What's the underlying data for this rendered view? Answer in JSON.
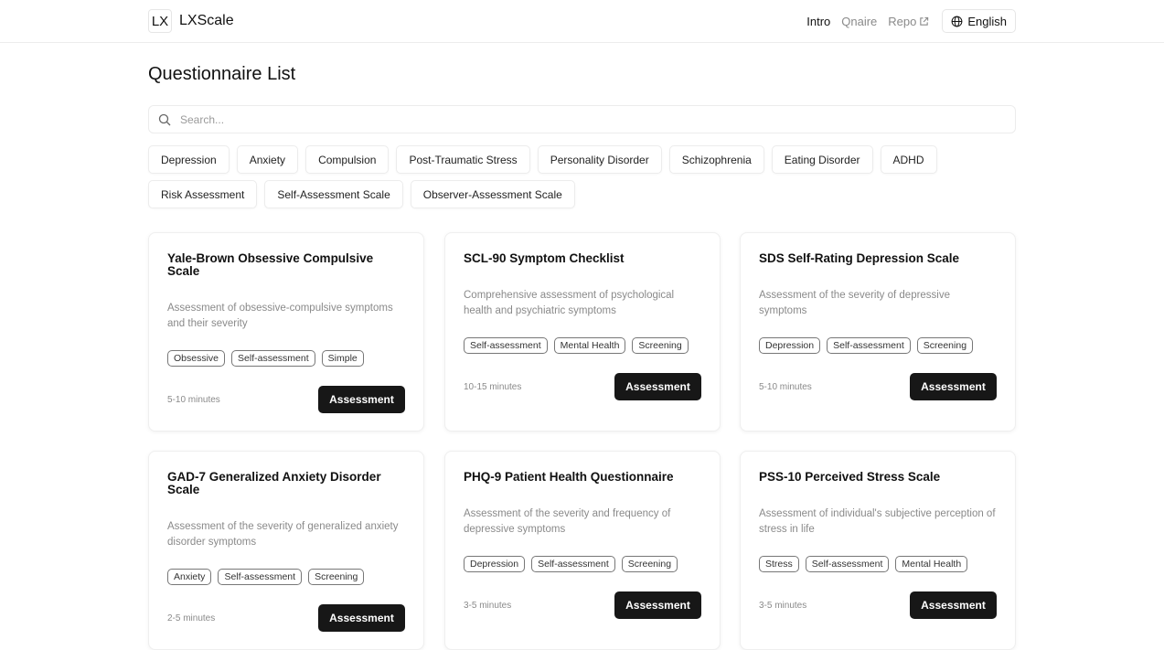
{
  "brand": {
    "mark": "LX",
    "name": "LXScale"
  },
  "nav": {
    "intro": "Intro",
    "qnaire": "Qnaire",
    "repo": "Repo",
    "language": "English"
  },
  "page": {
    "title": "Questionnaire List"
  },
  "search": {
    "placeholder": "Search...",
    "value": ""
  },
  "filters": {
    "row1": [
      "Depression",
      "Anxiety",
      "Compulsion",
      "Post-Traumatic Stress",
      "Personality Disorder",
      "Schizophrenia",
      "Eating Disorder",
      "ADHD"
    ],
    "row2": [
      "Risk Assessment",
      "Self-Assessment Scale",
      "Observer-Assessment Scale"
    ]
  },
  "cards": [
    {
      "title": "Yale-Brown Obsessive Compulsive Scale",
      "description": "Assessment of obsessive-compulsive symptoms and their severity",
      "tags": [
        "Obsessive",
        "Self-assessment",
        "Simple"
      ],
      "duration": "5-10 minutes",
      "button": "Assessment"
    },
    {
      "title": "SCL-90 Symptom Checklist",
      "description": "Comprehensive assessment of psychological health and psychiatric symptoms",
      "tags": [
        "Self-assessment",
        "Mental Health",
        "Screening"
      ],
      "duration": "10-15 minutes",
      "button": "Assessment"
    },
    {
      "title": "SDS Self-Rating Depression Scale",
      "description": "Assessment of the severity of depressive symptoms",
      "tags": [
        "Depression",
        "Self-assessment",
        "Screening"
      ],
      "duration": "5-10 minutes",
      "button": "Assessment"
    },
    {
      "title": "GAD-7 Generalized Anxiety Disorder Scale",
      "description": "Assessment of the severity of generalized anxiety disorder symptoms",
      "tags": [
        "Anxiety",
        "Self-assessment",
        "Screening"
      ],
      "duration": "2-5 minutes",
      "button": "Assessment"
    },
    {
      "title": "PHQ-9 Patient Health Questionnaire",
      "description": "Assessment of the severity and frequency of depressive symptoms",
      "tags": [
        "Depression",
        "Self-assessment",
        "Screening"
      ],
      "duration": "3-5 minutes",
      "button": "Assessment"
    },
    {
      "title": "PSS-10 Perceived Stress Scale",
      "description": "Assessment of individual's subjective perception of stress in life",
      "tags": [
        "Stress",
        "Self-assessment",
        "Mental Health"
      ],
      "duration": "3-5 minutes",
      "button": "Assessment"
    }
  ]
}
